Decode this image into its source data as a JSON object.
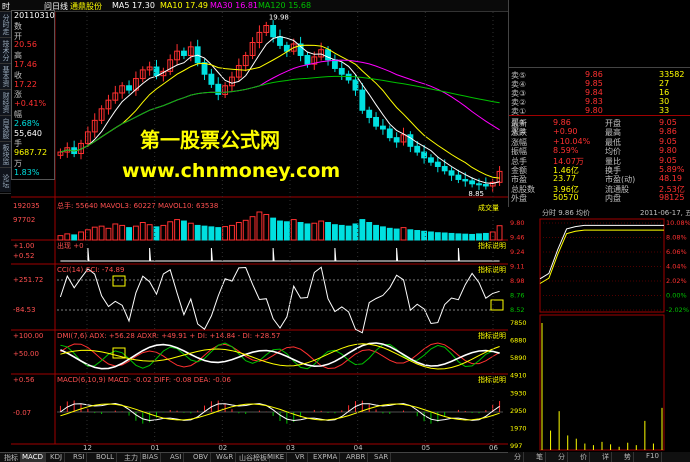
{
  "top": {
    "time": "时",
    "wenri": "问日线",
    "stock": "通鼎股份",
    "ma5": "MA5  17.30",
    "ma10": "MA10  17.49",
    "ma30": "MA30  16.81",
    "ma120": "MA120  15.68"
  },
  "left_tabs": [
    "分时走势",
    "技术分析",
    "基本资料",
    "财经资讯",
    "自选股",
    "板块监测",
    "论坛"
  ],
  "tooltip": [
    {
      "t": "20110310",
      "c": "#ffffff"
    },
    {
      "t": "数",
      "c": "#c0c0c0"
    },
    {
      "t": "开",
      "c": "#c0c0c0"
    },
    {
      "t": "20.56",
      "c": "#ff3030"
    },
    {
      "t": "高",
      "c": "#c0c0c0"
    },
    {
      "t": "17.46",
      "c": "#ff3030"
    },
    {
      "t": "收",
      "c": "#c0c0c0"
    },
    {
      "t": "17.22",
      "c": "#ff3030"
    },
    {
      "t": "涨",
      "c": "#c0c0c0"
    },
    {
      "t": "+0.41%",
      "c": "#ff3030"
    },
    {
      "t": "幅",
      "c": "#c0c0c0"
    },
    {
      "t": "2.68%",
      "c": "#00e0e0"
    },
    {
      "t": "55,640",
      "c": "#ffffff"
    },
    {
      "t": "手",
      "c": "#c0c0c0"
    },
    {
      "t": "9687.72",
      "c": "#ffff00"
    },
    {
      "t": "万",
      "c": "#c0c0c0"
    },
    {
      "t": "1.83%",
      "c": "#00e0e0"
    }
  ],
  "price_axis": {
    "high": "19.98",
    "low": "8.85"
  },
  "vol_panel": {
    "label": "总手: 55640  MAVOL3: 60227  MAVOL10: 63538",
    "tag": "成交量",
    "y1": "192035",
    "y2": "97702"
  },
  "k_panel": {
    "label": "出现 +0",
    "tag": "指标说明",
    "y1": "+1.00",
    "y2": "+0.52"
  },
  "cci_panel": {
    "label": "CCI(14)  CCI: -74.89",
    "tag": "指标说明",
    "y1": "+251.72",
    "y2": "-84.53"
  },
  "dmi_panel": {
    "label": "DMI(7,6)  ADX: +56.28   ADXR: +49.91   + DI: +14.84   - DI: +28.57",
    "tag": "指标说明",
    "y1": "+100.00",
    "y2": "+50.00"
  },
  "macd_panel": {
    "label": "MACD(6,10,9)  MACD: -0.02   DIFF: -0.08   DEA: -0.06",
    "tag": "指标说明",
    "y1": "+0.56",
    "y2": "-0.07"
  },
  "x_labels": [
    "12",
    "01",
    "02",
    "03",
    "04",
    "05",
    "06"
  ],
  "watermark": {
    "line1": "第一股票公式网",
    "line2": "www.chnmoney.com"
  },
  "orders": {
    "sell": [
      {
        "l": "卖⑤",
        "p": "9.86",
        "v": "33582"
      },
      {
        "l": "卖④",
        "p": "9.85",
        "v": "27"
      },
      {
        "l": "卖③",
        "p": "9.84",
        "v": "16"
      },
      {
        "l": "卖②",
        "p": "9.83",
        "v": "30"
      },
      {
        "l": "卖①",
        "p": "9.80",
        "v": "33"
      }
    ],
    "buy": [
      {
        "l": "买①",
        "p": "",
        "v": ""
      },
      {
        "l": "买②",
        "p": "",
        "v": ""
      }
    ]
  },
  "quote": [
    {
      "a": "最新",
      "b": "9.86",
      "c": "开盘",
      "d": "9.05"
    },
    {
      "a": "涨跌",
      "b": "+0.90",
      "c": "最高",
      "d": "9.86"
    },
    {
      "a": "涨幅",
      "b": "+10.04%",
      "c": "最低",
      "d": "9.05"
    },
    {
      "a": "振幅",
      "b": "8.59%",
      "c": "均价",
      "d": "9.80"
    },
    {
      "a": "总手",
      "b": "14.07万",
      "c": "量比",
      "d": "9.05"
    },
    {
      "a": "金额",
      "b": "1.46亿",
      "c": "换手",
      "d": "5.89%"
    },
    {
      "a": "市盈",
      "b": "23.77",
      "c": "市盈(动)",
      "d": "48.19"
    },
    {
      "a": "总股数",
      "b": "3.96亿",
      "c": "流通股",
      "d": "2.53亿"
    },
    {
      "a": "外盘",
      "b": "50570",
      "c": "内盘",
      "d": "98125"
    }
  ],
  "intraday": {
    "header": "分时  9.86  均价  ",
    "date": "2011-06-17, 五",
    "left_axis": [
      "9.80",
      "9.46",
      "9.24",
      "9.11",
      "8.98",
      "8.76",
      "8.52"
    ],
    "right_axis": [
      "10.08%",
      "8.08%",
      "6.06%",
      "4.04%",
      "2.02%",
      "0.00%",
      "-2.02%"
    ],
    "vol_axis": [
      "7850",
      "6880",
      "5890",
      "4910",
      "3930",
      "2950",
      "1970",
      "997"
    ],
    "price": [
      8.96,
      9.05,
      9.45,
      9.8,
      9.84,
      9.86,
      9.86,
      9.86,
      9.86,
      9.86,
      9.86,
      9.86,
      9.86,
      9.86,
      9.86
    ],
    "vol": [
      7850,
      1200,
      2400,
      900,
      700,
      400,
      300,
      500,
      350,
      200,
      450,
      300,
      1800,
      400,
      2600
    ]
  },
  "bottom_tabs": [
    "指标",
    "MACD",
    "KDJ",
    "RSI",
    "BOLL",
    "主力",
    "BIAS",
    "ASI",
    "OBV",
    "W&R",
    "山谷榜板",
    "MIKE",
    "VR",
    "EXPMA",
    "ARBR",
    "SAR"
  ],
  "right_tabs": [
    "分",
    "笔",
    "分",
    "价",
    "详",
    "势",
    "F10"
  ],
  "colors": {
    "up": "#ff3030",
    "down": "#00e0e0",
    "ma5": "#ffffff",
    "ma10": "#ffff00",
    "ma30": "#ff00ff",
    "ma120": "#00c000"
  },
  "chart_data": {
    "type": "bar",
    "title": "",
    "candles_close": [
      11.2,
      11.5,
      11.1,
      11.8,
      12.6,
      13.4,
      14.2,
      14.8,
      15.3,
      15.8,
      15.5,
      16.3,
      16.9,
      17.1,
      16.5,
      16.8,
      17.6,
      18.2,
      17.9,
      18.5,
      17.4,
      16.6,
      15.9,
      15.2,
      15.8,
      16.4,
      17.2,
      17.9,
      18.8,
      19.5,
      19.98,
      19.2,
      18.6,
      18.2,
      18.7,
      17.9,
      17.3,
      17.8,
      18.3,
      17.6,
      17.0,
      16.6,
      16.2,
      15.5,
      14.1,
      13.6,
      13.0,
      12.8,
      12.2,
      11.9,
      12.4,
      11.6,
      11.2,
      10.8,
      10.5,
      10.2,
      9.9,
      9.6,
      9.3,
      9.2,
      9.0,
      8.95,
      8.85,
      9.1,
      9.86
    ],
    "volume": [
      30,
      42,
      35,
      55,
      70,
      88,
      95,
      80,
      110,
      100,
      85,
      95,
      120,
      105,
      90,
      100,
      125,
      140,
      130,
      115,
      100,
      95,
      90,
      85,
      92,
      100,
      120,
      135,
      160,
      192,
      175,
      150,
      130,
      125,
      140,
      120,
      110,
      115,
      130,
      120,
      105,
      100,
      95,
      110,
      140,
      120,
      100,
      90,
      80,
      75,
      85,
      70,
      65,
      60,
      55,
      50,
      48,
      45,
      42,
      40,
      38,
      42,
      45,
      55,
      98
    ],
    "ylim": [
      8.5,
      20.5
    ]
  }
}
